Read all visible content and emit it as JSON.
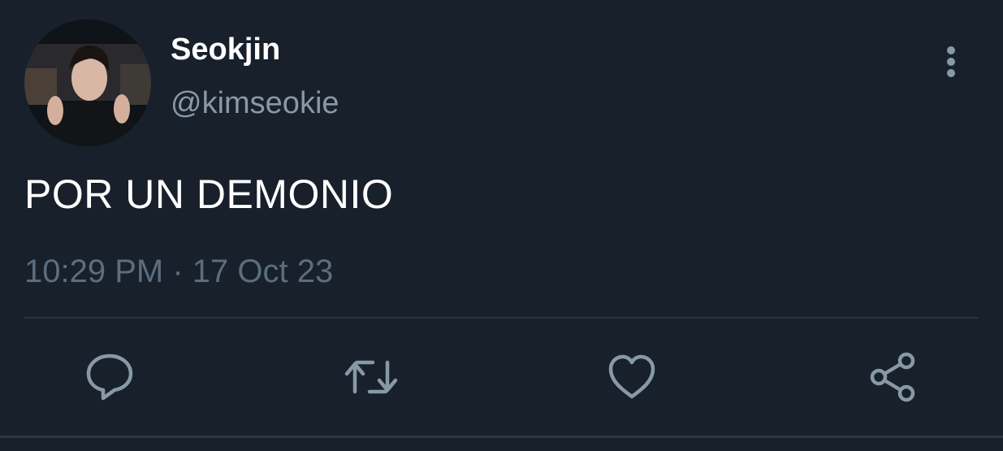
{
  "tweet": {
    "author": {
      "display_name": "Seokjin",
      "handle": "@kimseokie"
    },
    "text": "POR UN DEMONIO",
    "timestamp": "10:29 PM · 17 Oct 23"
  },
  "actions": [
    {
      "icon": "reply-icon"
    },
    {
      "icon": "retweet-icon"
    },
    {
      "icon": "like-icon"
    },
    {
      "icon": "share-icon"
    }
  ],
  "colors": {
    "background": "#17202b",
    "primary_text": "#ffffff",
    "secondary_text": "#8899a6",
    "divider": "#2b3641"
  }
}
